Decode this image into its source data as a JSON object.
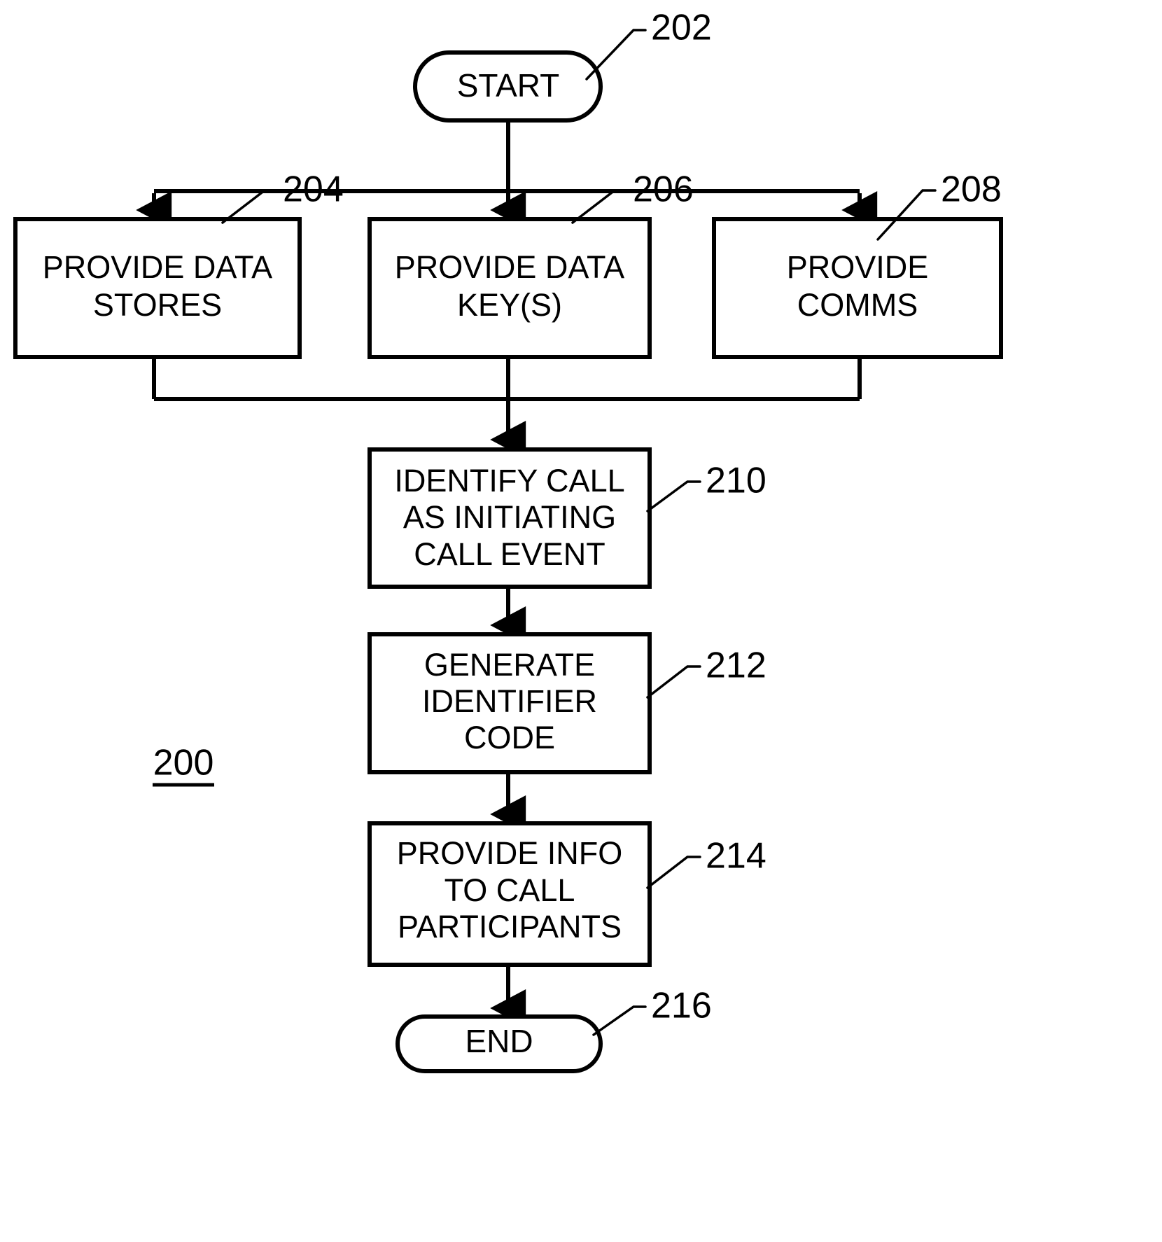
{
  "figure": {
    "reference_numeral": "200",
    "type": "patent-flowchart"
  },
  "nodes": [
    {
      "id": "start",
      "shape": "stadium",
      "label": "START",
      "ref": "202",
      "lines": [
        "START"
      ]
    },
    {
      "id": "provide-data-stores",
      "shape": "rectangle",
      "label": "PROVIDE DATA STORES",
      "ref": "204",
      "lines": [
        "PROVIDE DATA",
        "STORES"
      ]
    },
    {
      "id": "provide-data-keys",
      "shape": "rectangle",
      "label": "PROVIDE DATA KEY(S)",
      "ref": "206",
      "lines": [
        "PROVIDE DATA",
        "KEY(S)"
      ]
    },
    {
      "id": "provide-comms",
      "shape": "rectangle",
      "label": "PROVIDE COMMS",
      "ref": "208",
      "lines": [
        "PROVIDE",
        "COMMS"
      ]
    },
    {
      "id": "identify-call",
      "shape": "rectangle",
      "label": "IDENTIFY CALL AS INITIATING CALL EVENT",
      "ref": "210",
      "lines": [
        "IDENTIFY CALL",
        "AS INITIATING",
        "CALL EVENT"
      ]
    },
    {
      "id": "generate-identifier-code",
      "shape": "rectangle",
      "label": "GENERATE IDENTIFIER CODE",
      "ref": "212",
      "lines": [
        "GENERATE",
        "IDENTIFIER",
        "CODE"
      ]
    },
    {
      "id": "provide-info",
      "shape": "rectangle",
      "label": "PROVIDE INFO TO CALL PARTICIPANTS",
      "ref": "214",
      "lines": [
        "PROVIDE INFO",
        "TO CALL",
        "PARTICIPANTS"
      ]
    },
    {
      "id": "end",
      "shape": "stadium",
      "label": "END",
      "ref": "216",
      "lines": [
        "END"
      ]
    }
  ],
  "text": {
    "start": "START",
    "end": "END",
    "box204_line1": "PROVIDE DATA",
    "box204_line2": "STORES",
    "box206_line1": "PROVIDE DATA",
    "box206_line2": "KEY(S)",
    "box208_line1": "PROVIDE",
    "box208_line2": "COMMS",
    "box210_line1": "IDENTIFY CALL",
    "box210_line2": "AS INITIATING",
    "box210_line3": "CALL EVENT",
    "box212_line1": "GENERATE",
    "box212_line2": "IDENTIFIER",
    "box212_line3": "CODE",
    "box214_line1": "PROVIDE INFO",
    "box214_line2": "TO CALL",
    "box214_line3": "PARTICIPANTS"
  },
  "refs": {
    "r202": "202",
    "r204": "204",
    "r206": "206",
    "r208": "208",
    "r210": "210",
    "r212": "212",
    "r214": "214",
    "r216": "216",
    "r200": "200"
  },
  "colors": {
    "stroke": "#000000",
    "fill": "#ffffff",
    "text": "#000000"
  }
}
